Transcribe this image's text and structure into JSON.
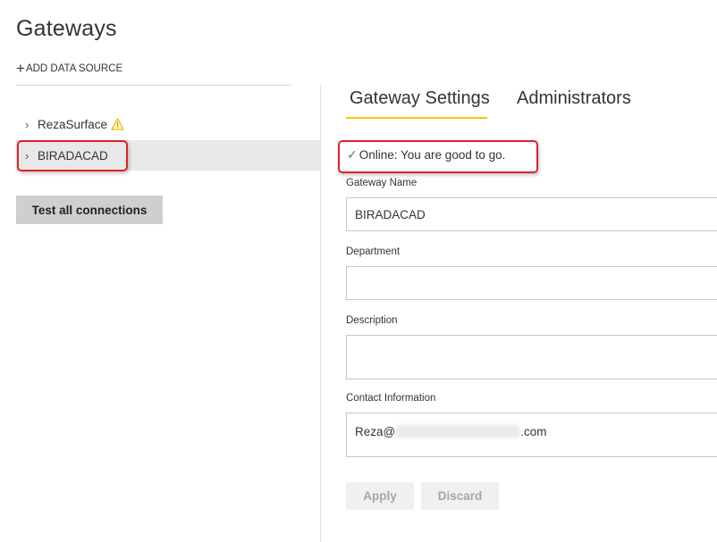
{
  "page": {
    "title": "Gateways"
  },
  "toolbar": {
    "add_data_source": "ADD DATA SOURCE",
    "add_icon": "plus-icon"
  },
  "gateways": [
    {
      "name": "RezaSurface",
      "has_warning": true,
      "selected": false
    },
    {
      "name": "BIRADACAD",
      "has_warning": false,
      "selected": true
    }
  ],
  "actions": {
    "test_all": "Test all connections"
  },
  "tabs": [
    {
      "label": "Gateway Settings",
      "active": true
    },
    {
      "label": "Administrators",
      "active": false
    }
  ],
  "status": {
    "text": "Online: You are good to go.",
    "icon": "check-icon"
  },
  "form": {
    "gateway_name": {
      "label": "Gateway Name",
      "value": "BIRADACAD"
    },
    "department": {
      "label": "Department",
      "value": ""
    },
    "description": {
      "label": "Description",
      "value": ""
    },
    "contact": {
      "label": "Contact Information",
      "value_prefix": "Reza@",
      "value_suffix": ".com"
    }
  },
  "buttons": {
    "apply": "Apply",
    "discard": "Discard"
  },
  "colors": {
    "accent_underline": "#f2c811",
    "highlight_border": "#e0202a",
    "status_check": "#3a8e3a",
    "warning": "#f2c811"
  }
}
